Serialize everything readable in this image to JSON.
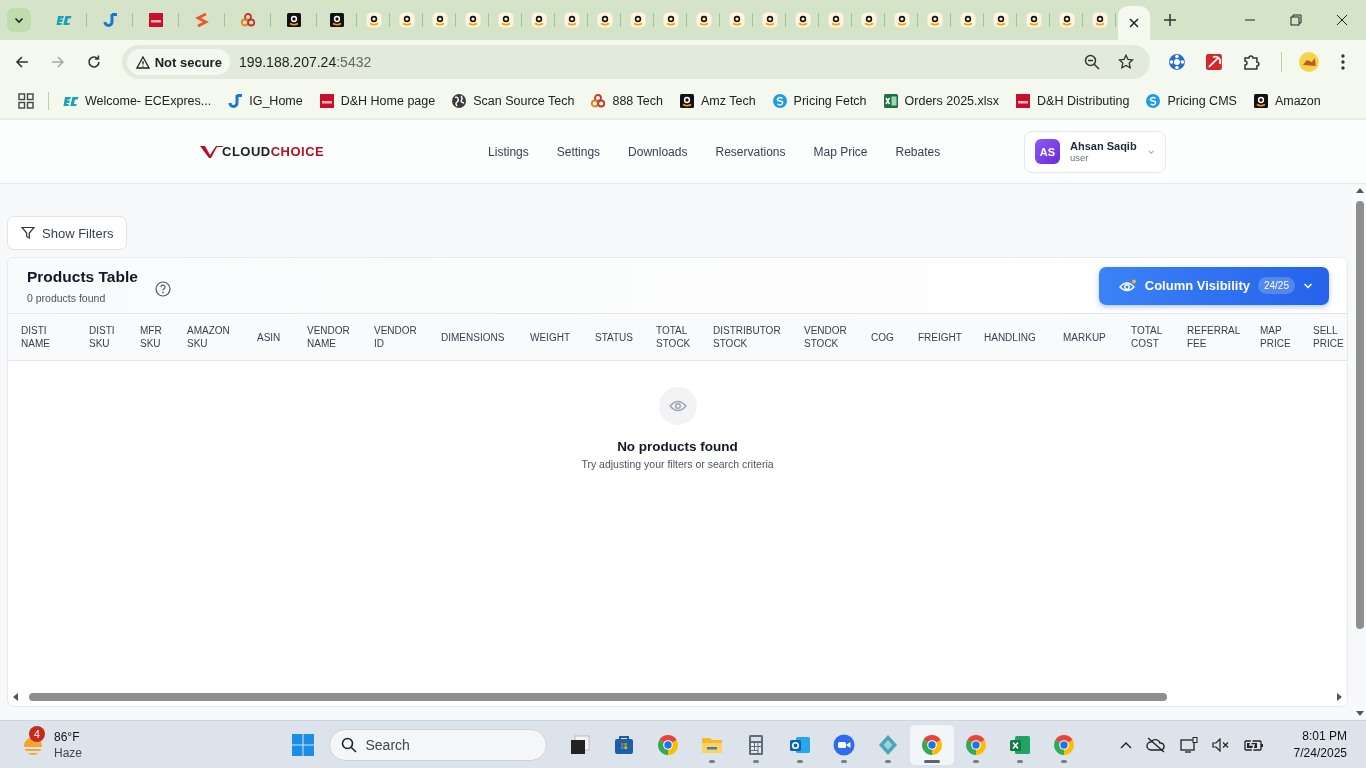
{
  "browser": {
    "tabs": [
      {
        "kind": "ec",
        "selected": false
      },
      {
        "kind": "ig",
        "selected": false
      },
      {
        "kind": "dh",
        "selected": false
      },
      {
        "kind": "chevron",
        "selected": false
      },
      {
        "kind": "rings",
        "selected": false
      },
      {
        "kind": "amazon-dark",
        "selected": false
      },
      {
        "kind": "amazon-dark",
        "selected": false
      },
      {
        "kind": "amazon",
        "selected": false
      },
      {
        "kind": "amazon",
        "selected": false
      },
      {
        "kind": "amazon",
        "selected": false
      },
      {
        "kind": "amazon",
        "selected": false
      },
      {
        "kind": "amazon",
        "selected": false
      },
      {
        "kind": "amazon",
        "selected": false
      },
      {
        "kind": "amazon",
        "selected": false
      },
      {
        "kind": "amazon",
        "selected": false
      },
      {
        "kind": "amazon",
        "selected": false
      },
      {
        "kind": "amazon",
        "selected": false
      },
      {
        "kind": "amazon",
        "selected": false
      },
      {
        "kind": "amazon",
        "selected": false
      },
      {
        "kind": "amazon",
        "selected": false
      },
      {
        "kind": "amazon",
        "selected": false
      },
      {
        "kind": "amazon",
        "selected": false
      },
      {
        "kind": "amazon",
        "selected": false
      },
      {
        "kind": "amazon",
        "selected": false
      },
      {
        "kind": "amazon",
        "selected": false
      },
      {
        "kind": "amazon",
        "selected": false
      },
      {
        "kind": "amazon",
        "selected": false
      },
      {
        "kind": "amazon",
        "selected": false
      },
      {
        "kind": "amazon",
        "selected": false
      },
      {
        "kind": "amazon",
        "selected": false
      },
      {
        "kind": "blank",
        "selected": true
      }
    ],
    "security_label": "Not secure",
    "url_host": "199.188.207.24",
    "url_port": ":5432",
    "bookmarks": [
      {
        "label": "Welcome- ECExpres...",
        "kind": "ec"
      },
      {
        "label": "IG_Home",
        "kind": "ig"
      },
      {
        "label": "D&H Home page",
        "kind": "dh"
      },
      {
        "label": "Scan Source Tech",
        "kind": "globe"
      },
      {
        "label": "888 Tech",
        "kind": "rings"
      },
      {
        "label": "Amz Tech",
        "kind": "amazon-dark"
      },
      {
        "label": "Pricing Fetch",
        "kind": "s-circle"
      },
      {
        "label": "Orders 2025.xlsx",
        "kind": "excel"
      },
      {
        "label": "D&H Distributing",
        "kind": "dh"
      },
      {
        "label": "Pricing CMS",
        "kind": "s-circle"
      },
      {
        "label": "Amazon",
        "kind": "amazon-dark"
      }
    ]
  },
  "app": {
    "logo_left": "CLOUD",
    "logo_right": "CHOICE",
    "nav": [
      "Listings",
      "Settings",
      "Downloads",
      "Reservations",
      "Map Price",
      "Rebates"
    ],
    "user": {
      "initials": "AS",
      "name": "Ahsan Saqib",
      "role": "user"
    },
    "filters_button": "Show Filters",
    "table": {
      "title": "Products Table",
      "count": "0 products found",
      "column_visibility": "Column Visibility",
      "visible_count": "24/25",
      "columns": [
        "DISTI NAME",
        "DISTI SKU",
        "MFR SKU",
        "AMAZON SKU",
        "ASIN",
        "VENDOR NAME",
        "VENDOR ID",
        "DIMENSIONS",
        "WEIGHT",
        "STATUS",
        "TOTAL STOCK",
        "DISTRIBUTOR STOCK",
        "VENDOR STOCK",
        "COG",
        "FREIGHT",
        "HANDLING",
        "MARKUP",
        "TOTAL COST",
        "REFERRAL FEE",
        "MAP PRICE",
        "SELL PRICE"
      ],
      "empty_title": "No products found",
      "empty_hint": "Try adjusting your filters or search criteria"
    }
  },
  "taskbar": {
    "weather_badge": "4",
    "temperature": "86°F",
    "condition": "Haze",
    "search_placeholder": "Search",
    "apps": [
      {
        "kind": "taskview",
        "selected": false,
        "running": false
      },
      {
        "kind": "store",
        "selected": false,
        "running": false
      },
      {
        "kind": "chrome",
        "selected": false,
        "running": false
      },
      {
        "kind": "folder",
        "selected": false,
        "running": true
      },
      {
        "kind": "calculator",
        "selected": false,
        "running": true
      },
      {
        "kind": "mail",
        "selected": false,
        "running": true
      },
      {
        "kind": "video",
        "selected": false,
        "running": true
      },
      {
        "kind": "diamond",
        "selected": false,
        "running": true
      },
      {
        "kind": "chrome",
        "selected": true,
        "running": true
      },
      {
        "kind": "chrome",
        "selected": false,
        "running": true
      },
      {
        "kind": "spreadsheet",
        "selected": false,
        "running": true
      },
      {
        "kind": "chrome",
        "selected": false,
        "running": true
      }
    ],
    "time": "8:01 PM",
    "date": "7/24/2025"
  }
}
